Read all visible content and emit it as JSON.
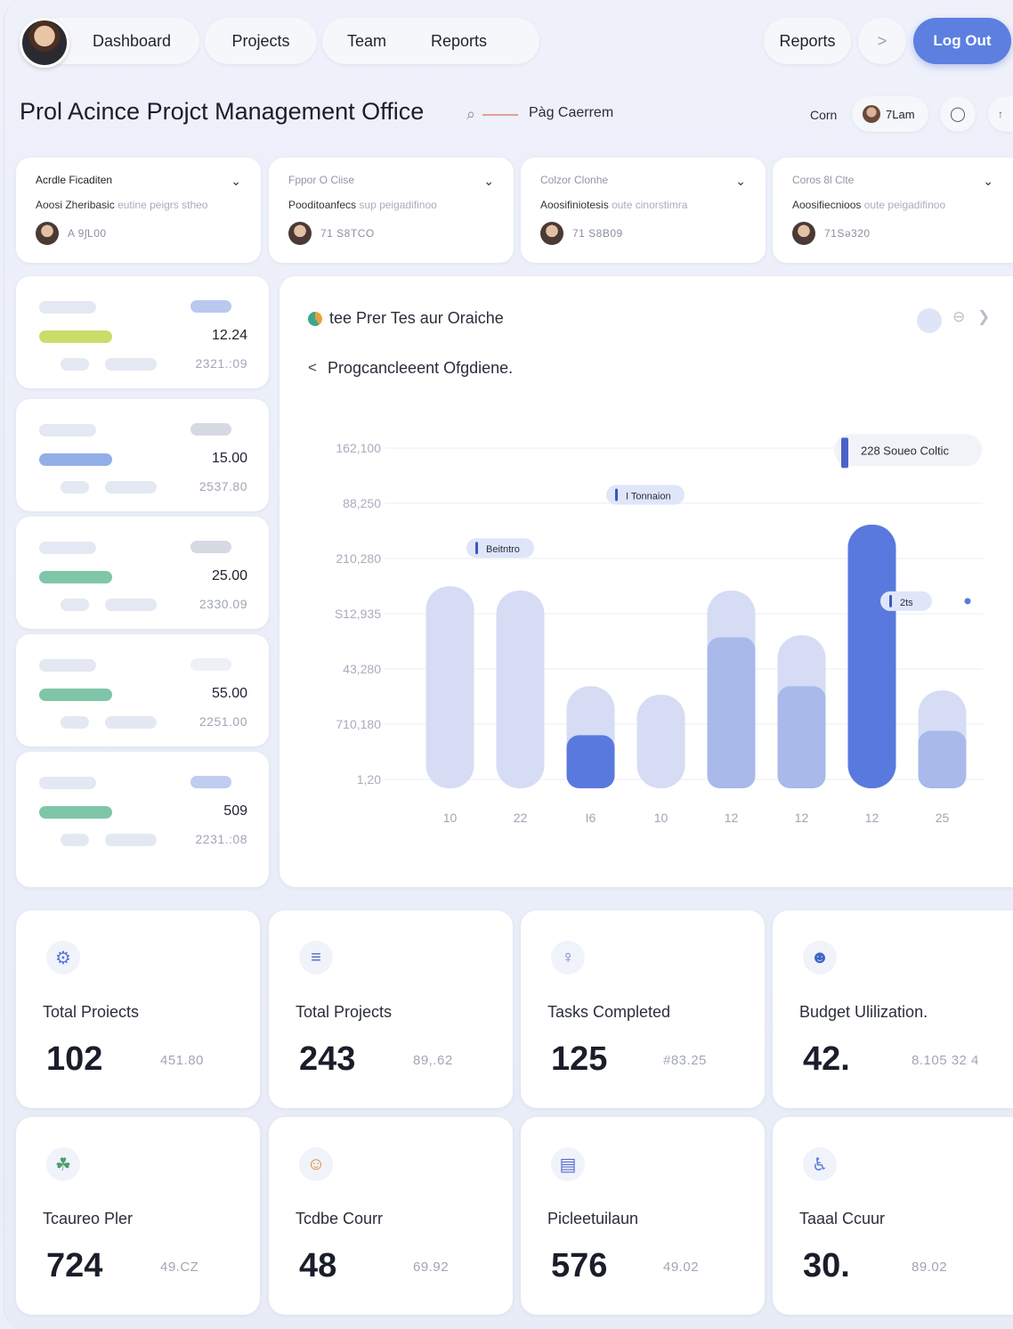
{
  "nav": {
    "items": [
      "Dashboard",
      "Projects",
      "Team",
      "Reports"
    ],
    "right_reports": "Reports",
    "next": ">",
    "logout": "Log Out"
  },
  "header": {
    "title": "Prol Acince Projct Management Office",
    "search_glyph": "⌕",
    "tag": "Pàg Caerrem",
    "right_label": "Corn",
    "chip": "7Lam"
  },
  "project_cards": [
    {
      "header": "Acrdle Ficaditen",
      "sub_bold": "Aoosi Zheribasic",
      "sub_light": "eutine peigrs stheo",
      "number": "A 9ʃL00"
    },
    {
      "header": "Fppor O Ciise",
      "sub_bold": "Pooditoanfecs",
      "sub_light": "sup peigadifinoo",
      "number": "71 S8TCO"
    },
    {
      "header": "Colzor Clonhe",
      "sub_bold": "Aoosifiniotesis",
      "sub_light": "oute cinorstimra",
      "number": "71 S8B09"
    },
    {
      "header": "Coros 8l Clte",
      "sub_bold": "Aoosifiecnioos",
      "sub_light": "oute peigadifinoo",
      "number": "71Sə320"
    }
  ],
  "stat_cards": [
    {
      "value": "12.24",
      "sub": "2321.:09",
      "accent": "#c9dd6a",
      "tag": "#b9c8ef"
    },
    {
      "value": "15.00",
      "sub": "2537.80",
      "accent": "#94aee8",
      "tag": "#d6d9e2"
    },
    {
      "value": "25.00",
      "sub": "2330.09",
      "accent": "#7fc6a8",
      "tag": "#d6d9e2"
    },
    {
      "value": "55.00",
      "sub": "2251.00",
      "accent": "#7fc6a8",
      "tag": "#eef0f5"
    },
    {
      "value": "509",
      "sub": "2231.:08",
      "accent": "#7fc6a8",
      "tag": "#bfcdf0"
    }
  ],
  "chart": {
    "title": "tee Prer Tes aur Oraiche",
    "subtitle": "Progcancleeent Ofgdiene.",
    "back": "<"
  },
  "chart_data": {
    "type": "bar",
    "categories": [
      "10",
      "22",
      "I6",
      "10",
      "12",
      "12",
      "12",
      "25"
    ],
    "y_ticks": [
      "162,100",
      "88,250",
      "210,280",
      "S12,935",
      "43,280",
      "710,180",
      "1,20"
    ],
    "series": [
      {
        "values": [
          95,
          93,
          48,
          44,
          93,
          72,
          124,
          46
        ]
      },
      {
        "values": [
          0,
          0,
          25,
          0,
          71,
          48,
          124,
          27
        ]
      }
    ],
    "ylim": [
      0,
      160
    ],
    "grid": true,
    "annotations": [
      {
        "label": "228 Soueo Coltic",
        "x_index": 7,
        "y": 159
      },
      {
        "label": "I Tonnaion",
        "x_index": 3,
        "y": 138
      },
      {
        "label": "Beitntro",
        "x_index": 1,
        "y": 113
      },
      {
        "label": "2ts",
        "x_index": 7,
        "y": 88
      }
    ],
    "colors": {
      "light": "#d5dcf4",
      "mid": "#a8b9ea",
      "dark": "#5a79de"
    }
  },
  "kpi_cards": [
    {
      "icon": "⚙",
      "icon_name": "rocket-icon",
      "label": "Total Proiects",
      "value": "102",
      "sub": "451.80"
    },
    {
      "icon": "≡",
      "icon_name": "projects-icon",
      "label": "Total Projects",
      "value": "243",
      "sub": "89,.62"
    },
    {
      "icon": "♀",
      "icon_name": "award-icon",
      "label": "Tasks Completed",
      "value": "125",
      "sub": "#83.25"
    },
    {
      "icon": "☻",
      "icon_name": "budget-icon",
      "label": "Budget Ulilization.",
      "value": "42.",
      "sub": "8.105 32 4"
    },
    {
      "icon": "☘",
      "icon_name": "plant-icon",
      "label": "Tcaureo Pler",
      "value": "724",
      "sub": "49.CZ"
    },
    {
      "icon": "☺",
      "icon_name": "person-icon",
      "label": "Tcdbe Courr",
      "value": "48",
      "sub": "69.92"
    },
    {
      "icon": "▤",
      "icon_name": "calendar-icon",
      "label": "Picleetuilaun",
      "value": "576",
      "sub": "49.02"
    },
    {
      "icon": "♿",
      "icon_name": "team-icon",
      "label": "Taaal Ccuur",
      "value": "30.",
      "sub": "89.02"
    }
  ]
}
